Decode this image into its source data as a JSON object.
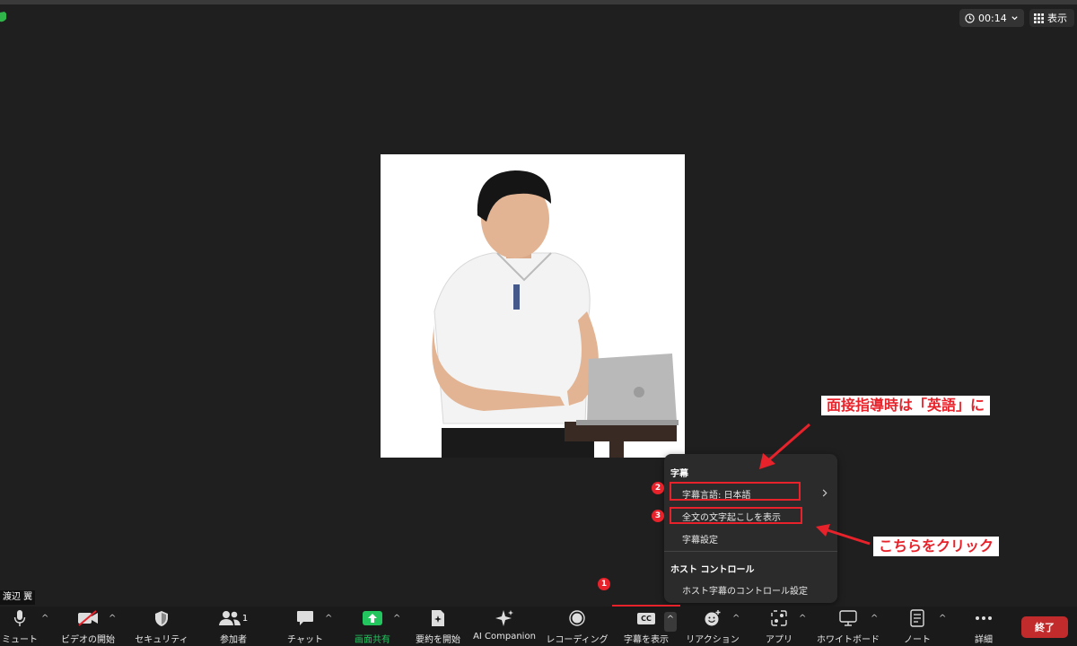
{
  "meeting": {
    "timer": "00:14",
    "view_label": "表示",
    "participant_name": "渡辺 翼"
  },
  "toolbar": {
    "mute": "ミュート",
    "video": "ビデオの開始",
    "security": "セキュリティ",
    "participants": "参加者",
    "participants_count": "1",
    "chat": "チャット",
    "share": "画面共有",
    "summary": "要約を開始",
    "ai": "AI Companion",
    "record": "レコーディング",
    "captions": "字幕を表示",
    "captions_icon_text": "CC",
    "reactions": "リアクション",
    "apps": "アプリ",
    "whiteboard": "ホワイトボード",
    "notes": "ノート",
    "more": "詳細",
    "end": "終了"
  },
  "captions_menu": {
    "header": "字幕",
    "language": "字幕言語: 日本語",
    "transcript": "全文の文字起こしを表示",
    "settings": "字幕設定",
    "host_header": "ホスト コントロール",
    "host_settings": "ホスト字幕のコントロール設定"
  },
  "annotations": {
    "step1": "1",
    "step2": "2",
    "step3": "3",
    "callout_english": "面接指導時は「英語」に",
    "callout_click": "こちらをクリック"
  },
  "colors": {
    "background": "#1f1f1f",
    "accent_red": "#e8222a",
    "share_green": "#22c55e",
    "end_red": "#c22b2b"
  }
}
